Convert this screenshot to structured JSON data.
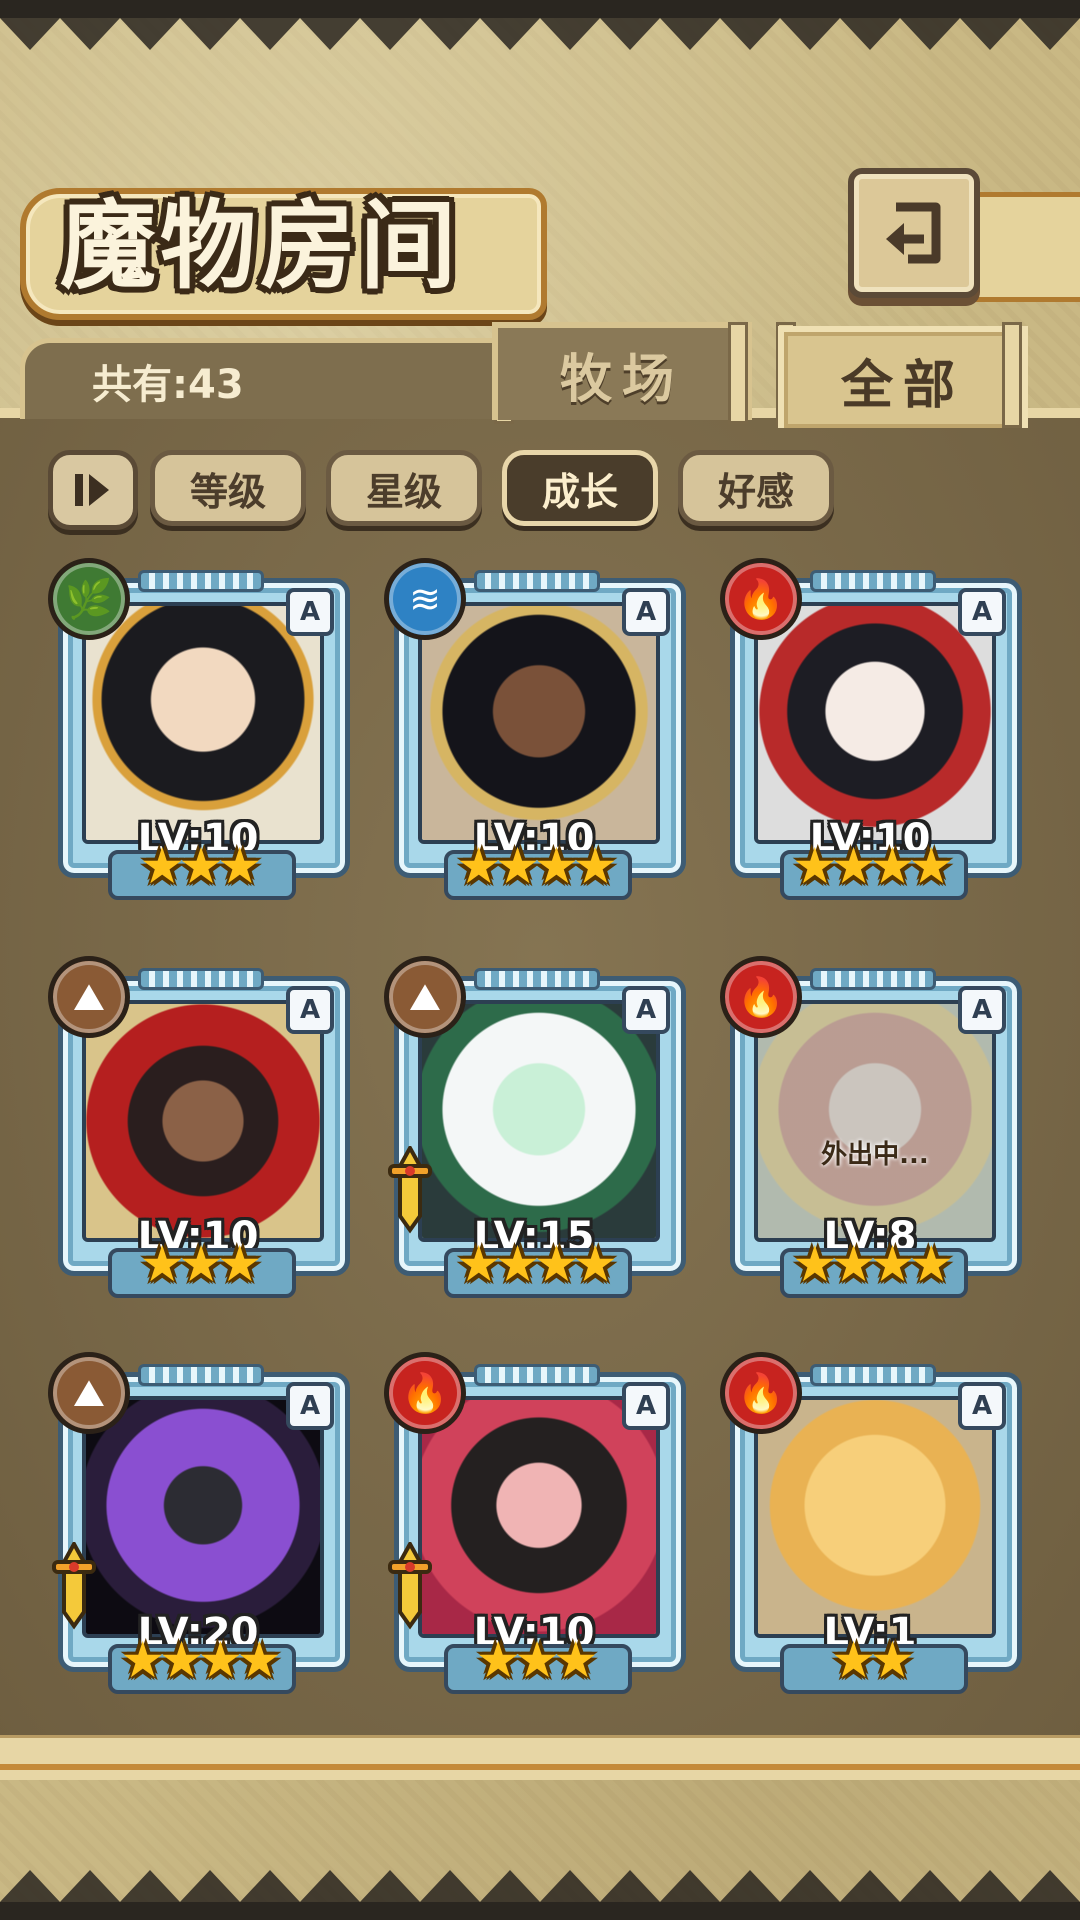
{
  "header": {
    "title": "魔物房间",
    "back_icon": "back-arrow-icon"
  },
  "summary": {
    "count_text": "共有:43"
  },
  "tabs": [
    {
      "label": "牧场",
      "active": false
    },
    {
      "label": "全部",
      "active": true
    }
  ],
  "sort": {
    "toggle_label": "I⏵",
    "options": [
      {
        "label": "等级",
        "active": false
      },
      {
        "label": "星级",
        "active": false
      },
      {
        "label": "成长",
        "active": true
      },
      {
        "label": "好感",
        "active": false
      }
    ]
  },
  "monsters": [
    {
      "element": "nature",
      "rarity": "A",
      "level": "LV:10",
      "stars": "★★★",
      "star_count": 3,
      "sword": false,
      "status": ""
    },
    {
      "element": "water",
      "rarity": "A",
      "level": "LV:10",
      "stars": "★★★★",
      "star_count": 4,
      "sword": false,
      "status": ""
    },
    {
      "element": "fire",
      "rarity": "A",
      "level": "LV:10",
      "stars": "★★★★",
      "star_count": 4,
      "sword": false,
      "status": ""
    },
    {
      "element": "earth",
      "rarity": "A",
      "level": "LV:10",
      "stars": "★★★",
      "star_count": 3,
      "sword": false,
      "status": ""
    },
    {
      "element": "earth",
      "rarity": "A",
      "level": "LV:15",
      "stars": "★★★★",
      "star_count": 4,
      "sword": true,
      "status": ""
    },
    {
      "element": "fire",
      "rarity": "A",
      "level": "LV:8",
      "stars": "★★★★",
      "star_count": 4,
      "sword": false,
      "status": "外出中..."
    },
    {
      "element": "earth",
      "rarity": "A",
      "level": "LV:20",
      "stars": "★★★★",
      "star_count": 4,
      "sword": true,
      "status": ""
    },
    {
      "element": "fire",
      "rarity": "A",
      "level": "LV:10",
      "stars": "★★★",
      "star_count": 3,
      "sword": true,
      "status": ""
    },
    {
      "element": "fire",
      "rarity": "A",
      "level": "LV:1",
      "stars": "★★",
      "star_count": 2,
      "sword": false,
      "status": ""
    }
  ],
  "colors": {
    "parchment": "#c9b884",
    "panel": "#7a6a4a",
    "card_frame": "#a9d8ea",
    "star": "#ffc21a",
    "element_nature": "#3f7a33",
    "element_water": "#2e82c4",
    "element_fire": "#c7231f",
    "element_earth": "#8a5a35"
  }
}
